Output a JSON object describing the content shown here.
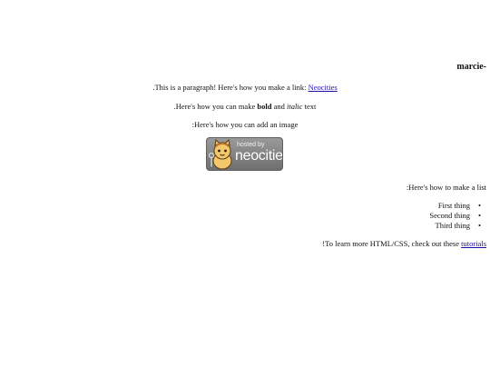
{
  "header": {
    "site_name": "marcie-"
  },
  "content": {
    "para_link_text": ".This is a paragraph! Here's how you make a link:",
    "para_link_label": "Neocities",
    "format_prefix": ".Here's how you can make",
    "format_bold": "bold",
    "format_middle": "and",
    "format_italic": "italic",
    "format_suffix": "text",
    "image_intro": ":Here's how you can add an image",
    "badge": {
      "hosted_by": "hosted by",
      "brand": "neocities"
    },
    "list_intro": ":Here's how to make a list",
    "list_items": [
      "First thing",
      "Second thing",
      "Third thing"
    ],
    "outro_text": "!To learn more HTML/CSS, check out these",
    "outro_link": "tutorials"
  }
}
